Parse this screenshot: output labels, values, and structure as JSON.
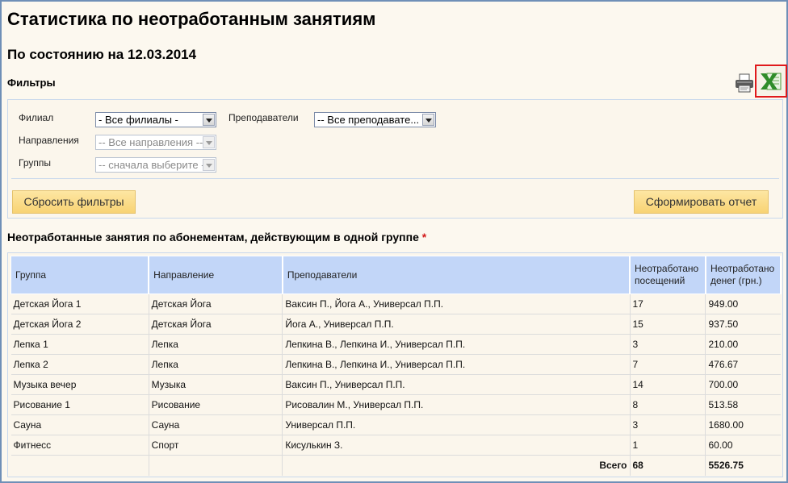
{
  "page": {
    "title": "Статистика по неотработанным занятиям",
    "as_of": "По состоянию на 12.03.2014",
    "filters_heading": "Фильтры"
  },
  "icons": {
    "print": "printer-icon",
    "export": "excel-icon"
  },
  "filters": {
    "branch_label": "Филиал",
    "branch_value": "- Все филиалы -",
    "teachers_label": "Преподаватели",
    "teachers_value": "-- Все преподавате...",
    "direction_label": "Направления",
    "direction_value": "-- Все направления --",
    "groups_label": "Группы",
    "groups_value": "-- сначала выберите --",
    "reset_label": "Сбросить фильтры",
    "submit_label": "Сформировать отчет"
  },
  "report": {
    "heading": "Неотработанные занятия по абонементам, действующим в одной группе",
    "star": "*",
    "columns": [
      "Группа",
      "Направление",
      "Преподаватели",
      "Неотработано посещений",
      "Неотработано денег (грн.)"
    ],
    "rows": [
      [
        "Детская Йога 1",
        "Детская Йога",
        "Ваксин П., Йога А., Универсал П.П.",
        "17",
        "949.00"
      ],
      [
        "Детская Йога 2",
        "Детская Йога",
        "Йога А., Универсал П.П.",
        "15",
        "937.50"
      ],
      [
        "Лепка 1",
        "Лепка",
        "Лепкина В., Лепкина И., Универсал П.П.",
        "3",
        "210.00"
      ],
      [
        "Лепка 2",
        "Лепка",
        "Лепкина В., Лепкина И., Универсал П.П.",
        "7",
        "476.67"
      ],
      [
        "Музыка вечер",
        "Музыка",
        "Ваксин П., Универсал П.П.",
        "14",
        "700.00"
      ],
      [
        "Рисование 1",
        "Рисование",
        "Рисовалин М., Универсал П.П.",
        "8",
        "513.58"
      ],
      [
        "Сауна",
        "Сауна",
        "Универсал П.П.",
        "3",
        "1680.00"
      ],
      [
        "Фитнесс",
        "Спорт",
        "Кисулькин З.",
        "1",
        "60.00"
      ]
    ],
    "total_label": "Всего",
    "total_visits": "68",
    "total_money": "5526.75"
  }
}
